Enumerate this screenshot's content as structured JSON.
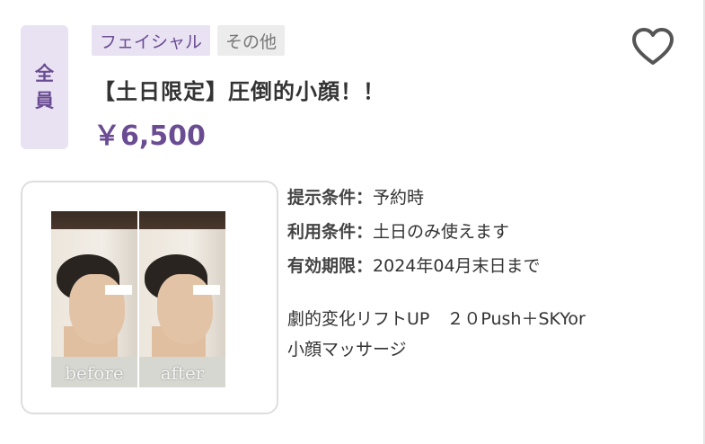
{
  "target_badge": {
    "line1": "全",
    "line2": "員"
  },
  "tags": [
    {
      "label": "フェイシャル"
    },
    {
      "label": "その他"
    }
  ],
  "favorite_icon": "heart-outline-icon",
  "title": "【土日限定】圧倒的小顔！！",
  "price": "￥6,500",
  "images": {
    "before_caption": "before",
    "after_caption": "after"
  },
  "conditions": [
    {
      "label": "提示条件",
      "separator": "：",
      "value": "予約時"
    },
    {
      "label": "利用条件",
      "separator": "：",
      "value": "土日のみ使えます"
    },
    {
      "label": "有効期限",
      "separator": "：",
      "value": "2024年04月末日まで"
    }
  ],
  "description": {
    "line1": "劇的変化リフトUP　２０Push＋SKYor",
    "line2": "小顔マッサージ"
  },
  "colors": {
    "accent": "#6a4c93",
    "badge_bg": "#e9e2f3",
    "tag_other_bg": "#ececec"
  }
}
